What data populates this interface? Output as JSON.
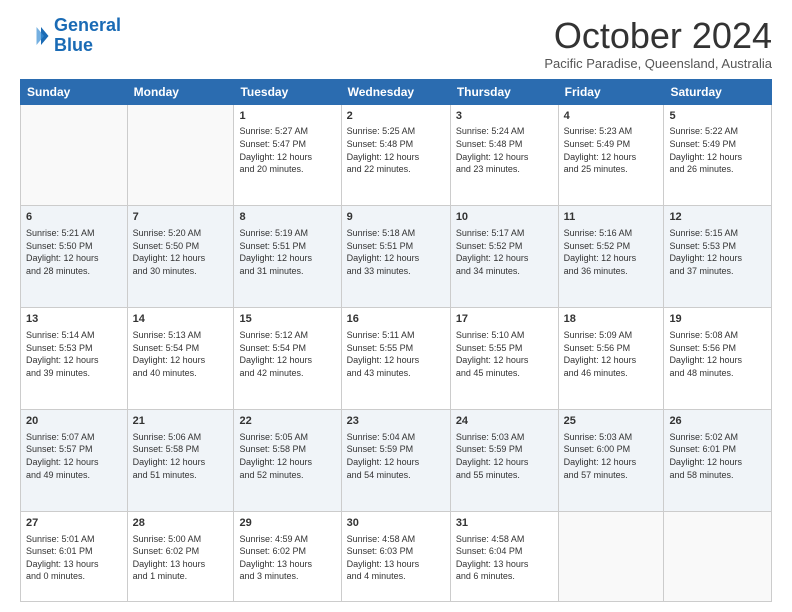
{
  "logo": {
    "line1": "General",
    "line2": "Blue"
  },
  "header": {
    "month": "October 2024",
    "location": "Pacific Paradise, Queensland, Australia"
  },
  "days_of_week": [
    "Sunday",
    "Monday",
    "Tuesday",
    "Wednesday",
    "Thursday",
    "Friday",
    "Saturday"
  ],
  "weeks": [
    [
      {
        "day": "",
        "info": ""
      },
      {
        "day": "",
        "info": ""
      },
      {
        "day": "1",
        "info": "Sunrise: 5:27 AM\nSunset: 5:47 PM\nDaylight: 12 hours\nand 20 minutes."
      },
      {
        "day": "2",
        "info": "Sunrise: 5:25 AM\nSunset: 5:48 PM\nDaylight: 12 hours\nand 22 minutes."
      },
      {
        "day": "3",
        "info": "Sunrise: 5:24 AM\nSunset: 5:48 PM\nDaylight: 12 hours\nand 23 minutes."
      },
      {
        "day": "4",
        "info": "Sunrise: 5:23 AM\nSunset: 5:49 PM\nDaylight: 12 hours\nand 25 minutes."
      },
      {
        "day": "5",
        "info": "Sunrise: 5:22 AM\nSunset: 5:49 PM\nDaylight: 12 hours\nand 26 minutes."
      }
    ],
    [
      {
        "day": "6",
        "info": "Sunrise: 5:21 AM\nSunset: 5:50 PM\nDaylight: 12 hours\nand 28 minutes."
      },
      {
        "day": "7",
        "info": "Sunrise: 5:20 AM\nSunset: 5:50 PM\nDaylight: 12 hours\nand 30 minutes."
      },
      {
        "day": "8",
        "info": "Sunrise: 5:19 AM\nSunset: 5:51 PM\nDaylight: 12 hours\nand 31 minutes."
      },
      {
        "day": "9",
        "info": "Sunrise: 5:18 AM\nSunset: 5:51 PM\nDaylight: 12 hours\nand 33 minutes."
      },
      {
        "day": "10",
        "info": "Sunrise: 5:17 AM\nSunset: 5:52 PM\nDaylight: 12 hours\nand 34 minutes."
      },
      {
        "day": "11",
        "info": "Sunrise: 5:16 AM\nSunset: 5:52 PM\nDaylight: 12 hours\nand 36 minutes."
      },
      {
        "day": "12",
        "info": "Sunrise: 5:15 AM\nSunset: 5:53 PM\nDaylight: 12 hours\nand 37 minutes."
      }
    ],
    [
      {
        "day": "13",
        "info": "Sunrise: 5:14 AM\nSunset: 5:53 PM\nDaylight: 12 hours\nand 39 minutes."
      },
      {
        "day": "14",
        "info": "Sunrise: 5:13 AM\nSunset: 5:54 PM\nDaylight: 12 hours\nand 40 minutes."
      },
      {
        "day": "15",
        "info": "Sunrise: 5:12 AM\nSunset: 5:54 PM\nDaylight: 12 hours\nand 42 minutes."
      },
      {
        "day": "16",
        "info": "Sunrise: 5:11 AM\nSunset: 5:55 PM\nDaylight: 12 hours\nand 43 minutes."
      },
      {
        "day": "17",
        "info": "Sunrise: 5:10 AM\nSunset: 5:55 PM\nDaylight: 12 hours\nand 45 minutes."
      },
      {
        "day": "18",
        "info": "Sunrise: 5:09 AM\nSunset: 5:56 PM\nDaylight: 12 hours\nand 46 minutes."
      },
      {
        "day": "19",
        "info": "Sunrise: 5:08 AM\nSunset: 5:56 PM\nDaylight: 12 hours\nand 48 minutes."
      }
    ],
    [
      {
        "day": "20",
        "info": "Sunrise: 5:07 AM\nSunset: 5:57 PM\nDaylight: 12 hours\nand 49 minutes."
      },
      {
        "day": "21",
        "info": "Sunrise: 5:06 AM\nSunset: 5:58 PM\nDaylight: 12 hours\nand 51 minutes."
      },
      {
        "day": "22",
        "info": "Sunrise: 5:05 AM\nSunset: 5:58 PM\nDaylight: 12 hours\nand 52 minutes."
      },
      {
        "day": "23",
        "info": "Sunrise: 5:04 AM\nSunset: 5:59 PM\nDaylight: 12 hours\nand 54 minutes."
      },
      {
        "day": "24",
        "info": "Sunrise: 5:03 AM\nSunset: 5:59 PM\nDaylight: 12 hours\nand 55 minutes."
      },
      {
        "day": "25",
        "info": "Sunrise: 5:03 AM\nSunset: 6:00 PM\nDaylight: 12 hours\nand 57 minutes."
      },
      {
        "day": "26",
        "info": "Sunrise: 5:02 AM\nSunset: 6:01 PM\nDaylight: 12 hours\nand 58 minutes."
      }
    ],
    [
      {
        "day": "27",
        "info": "Sunrise: 5:01 AM\nSunset: 6:01 PM\nDaylight: 13 hours\nand 0 minutes."
      },
      {
        "day": "28",
        "info": "Sunrise: 5:00 AM\nSunset: 6:02 PM\nDaylight: 13 hours\nand 1 minute."
      },
      {
        "day": "29",
        "info": "Sunrise: 4:59 AM\nSunset: 6:02 PM\nDaylight: 13 hours\nand 3 minutes."
      },
      {
        "day": "30",
        "info": "Sunrise: 4:58 AM\nSunset: 6:03 PM\nDaylight: 13 hours\nand 4 minutes."
      },
      {
        "day": "31",
        "info": "Sunrise: 4:58 AM\nSunset: 6:04 PM\nDaylight: 13 hours\nand 6 minutes."
      },
      {
        "day": "",
        "info": ""
      },
      {
        "day": "",
        "info": ""
      }
    ]
  ]
}
